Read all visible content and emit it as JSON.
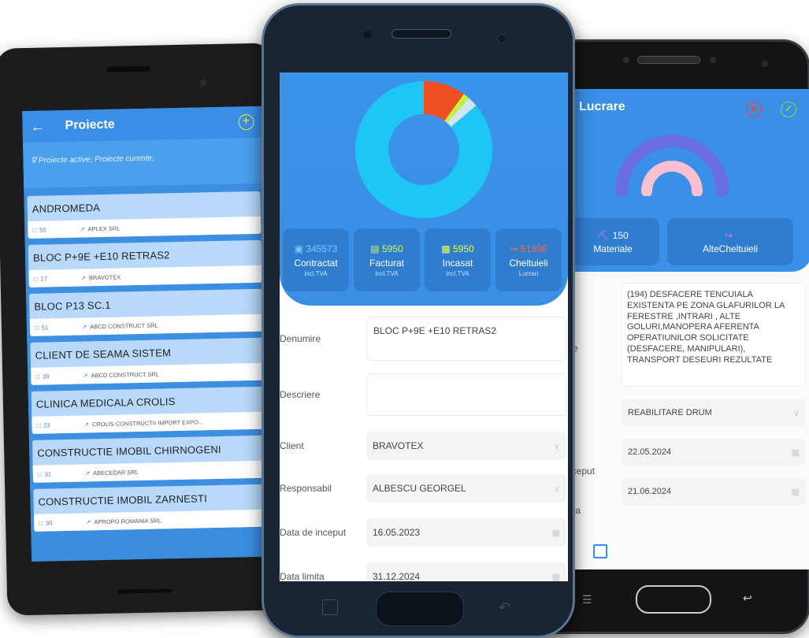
{
  "left_app": {
    "header": {
      "back_icon": "arrow-left-icon",
      "title": "Proiecte",
      "add_icon": "plus-circle-icon"
    },
    "filter_text": "Proiecte active; Proiecte curente;",
    "projects": [
      {
        "name": "ANDROMEDA",
        "count": "55",
        "client": "APLEX SRL"
      },
      {
        "name": "BLOC P+9E +E10 RETRAS2",
        "count": "17",
        "client": "BRAVOTEX"
      },
      {
        "name": "BLOC P13 SC.1",
        "count": "51",
        "client": "ABCD CONSTRUCT SRL"
      },
      {
        "name": "CLIENT DE SEAMA SISTEM",
        "count": "39",
        "client": "ABCD CONSTRUCT SRL"
      },
      {
        "name": "CLINICA MEDICALA CROLIS",
        "count": "23",
        "client": "CROLIS CONSTRUCTII IMPORT EXPO..."
      },
      {
        "name": "CONSTRUCTIE IMOBIL CHIRNOGENI",
        "count": "31",
        "client": "ABECEDAR SRL"
      },
      {
        "name": "CONSTRUCTIE IMOBIL ZARNESTI",
        "count": "30",
        "client": "APROPO ROMANIA SRL"
      }
    ]
  },
  "center_app": {
    "donut": {
      "slices": [
        {
          "value": 51606,
          "color": "#1ec6f5"
        },
        {
          "value": 5950,
          "color": "#f04e23"
        },
        {
          "value": 920,
          "color": "#c7f23a"
        },
        {
          "value": 1450,
          "color": "#cfe6f5"
        }
      ],
      "note": ""
    },
    "tiles": [
      {
        "value": "345573",
        "label": "Contractat",
        "sub": "incl.TVA",
        "color": "#6fd0ff"
      },
      {
        "value": "5950",
        "label": "Facturat",
        "sub": "incl.TVA",
        "color": "#c9ff63"
      },
      {
        "value": "5950",
        "label": "Incasat",
        "sub": "incl.TVA",
        "color": "#eaff4a"
      },
      {
        "value": "51606",
        "label": "Cheltuieli",
        "sub": "Lucrari",
        "color": "#ff6a3d"
      }
    ],
    "form": {
      "denumire_label": "Denumire",
      "denumire_value": "BLOC P+9E +E10 RETRAS2",
      "descriere_label": "Descriere",
      "descriere_value": "",
      "client_label": "Client",
      "client_value": "BRAVOTEX",
      "responsabil_label": "Responsabil",
      "responsabil_value": "ALBESCU GEORGEL",
      "data_inceput_label": "Data de inceput",
      "data_inceput_value": "16.05.2023",
      "data_limita_label": "Data limita",
      "data_limita_value": "31.12.2024"
    }
  },
  "right_app": {
    "header": {
      "title": "Lucrare",
      "close_icon": "x-circle-icon",
      "ok_icon": "check-circle-icon"
    },
    "gauge": {
      "level": 0.5
    },
    "tiles": [
      {
        "value": "150",
        "label": "Materiale"
      },
      {
        "value": "",
        "label": "AlteCheltuieli"
      }
    ],
    "description": "(194) DESFACERE TENCUIALA EXISTENTA PE ZONA GLAFURILOR LA FERESTRE ,INTRARI , ALTE GOLURI,MANOPERA AFERENTA OPERATIUNILOR SOLICITATE (DESFACERE, MANIPULARI), TRANSPORT DESEURI REZULTATE",
    "desc_label_fragment": "e",
    "category_value": "REABILITARE DRUM",
    "start_label_fragment": "nceput",
    "start_value": "22.05.2024",
    "end_label_fragment": "ta",
    "end_value": "21.06.2024"
  }
}
